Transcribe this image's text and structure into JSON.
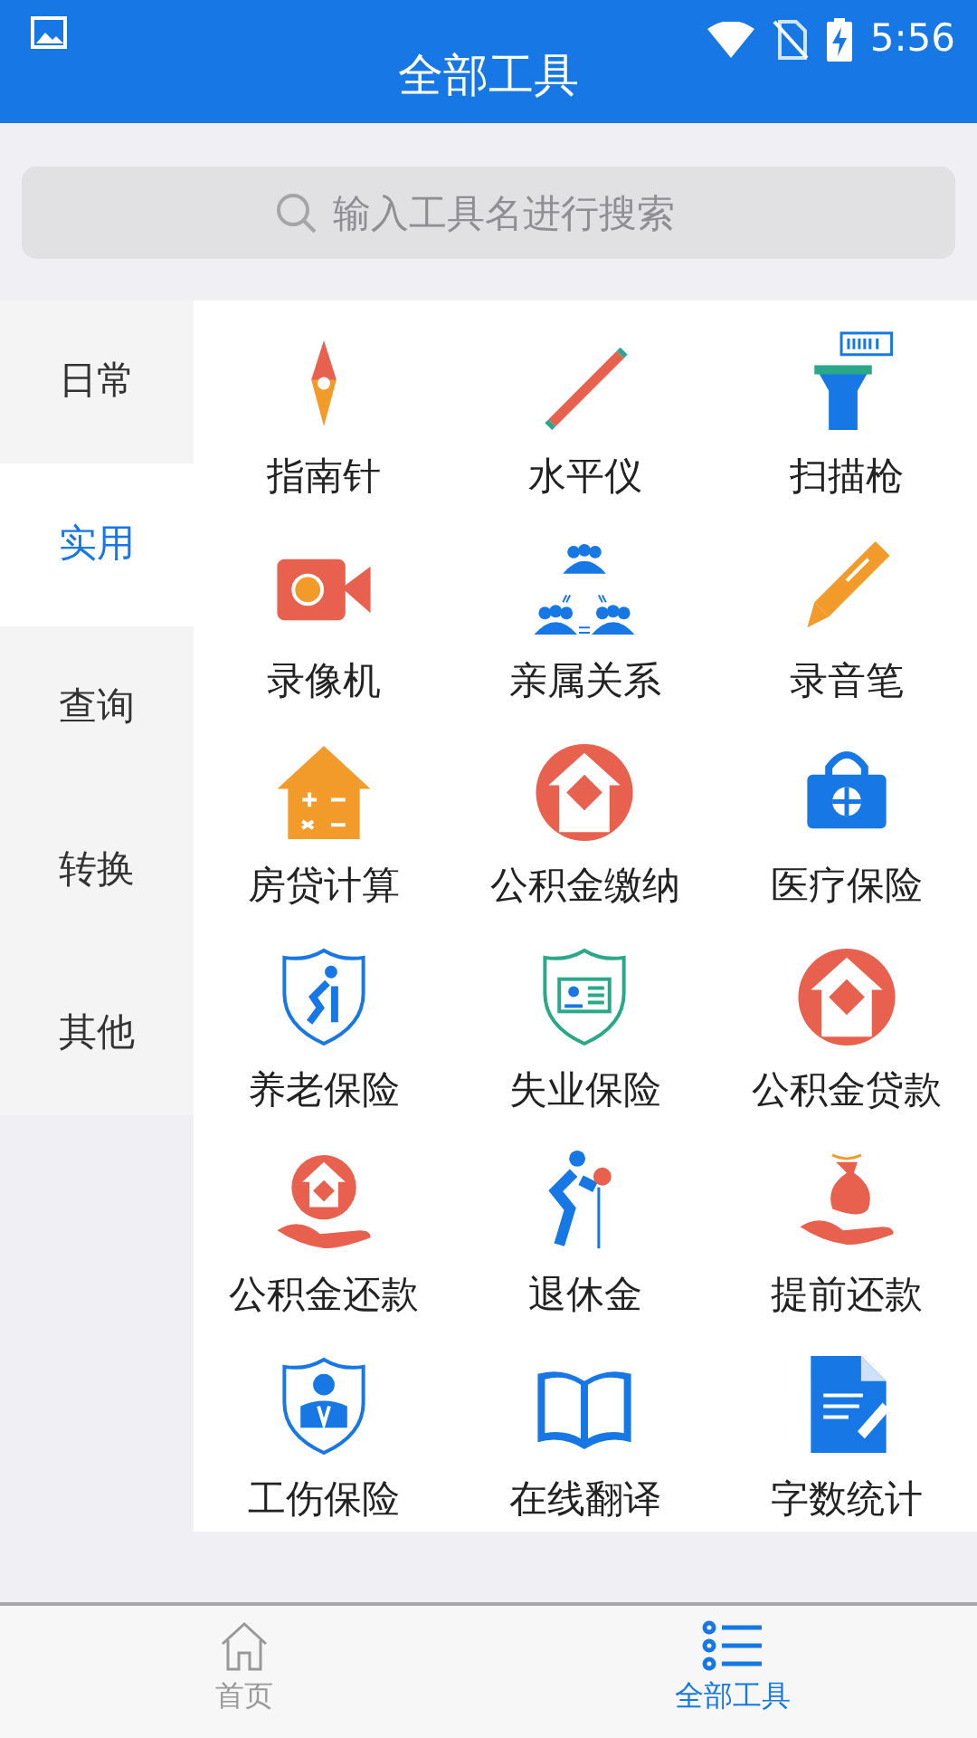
{
  "status_bar": {
    "time": "5:56"
  },
  "header": {
    "title": "全部工具"
  },
  "search": {
    "placeholder": "输入工具名进行搜索"
  },
  "categories": [
    {
      "label": "日常",
      "selected": false
    },
    {
      "label": "实用",
      "selected": true
    },
    {
      "label": "查询",
      "selected": false
    },
    {
      "label": "转换",
      "selected": false
    },
    {
      "label": "其他",
      "selected": false
    }
  ],
  "tools": [
    {
      "label": "指南针"
    },
    {
      "label": "水平仪"
    },
    {
      "label": "扫描枪"
    },
    {
      "label": "录像机"
    },
    {
      "label": "亲属关系"
    },
    {
      "label": "录音笔"
    },
    {
      "label": "房贷计算"
    },
    {
      "label": "公积金缴纳"
    },
    {
      "label": "医疗保险"
    },
    {
      "label": "养老保险"
    },
    {
      "label": "失业保险"
    },
    {
      "label": "公积金贷款"
    },
    {
      "label": "公积金还款"
    },
    {
      "label": "退休金"
    },
    {
      "label": "提前还款"
    },
    {
      "label": "工伤保险"
    },
    {
      "label": "在线翻译"
    },
    {
      "label": "字数统计"
    }
  ],
  "bottom_tabs": [
    {
      "label": "首页",
      "selected": false
    },
    {
      "label": "全部工具",
      "selected": true
    }
  ]
}
